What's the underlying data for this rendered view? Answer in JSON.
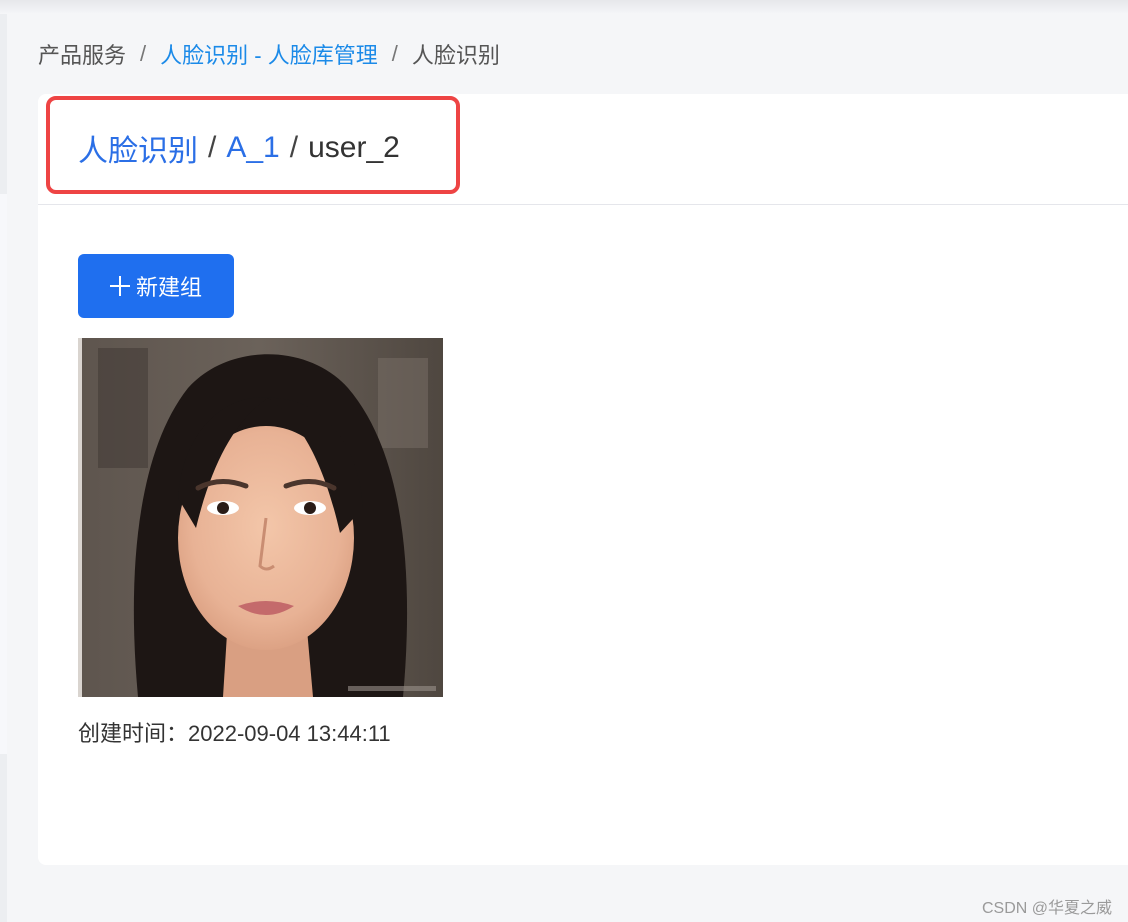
{
  "breadcrumb": {
    "items": [
      "产品服务",
      "人脸识别 - 人脸库管理",
      "人脸识别"
    ],
    "separator": "/"
  },
  "header": {
    "crumbs": [
      "人脸识别",
      "A_1",
      "user_2"
    ],
    "separator": "/"
  },
  "toolbar": {
    "new_group_label": "新建组",
    "new_group_icon": "plus-icon"
  },
  "face": {
    "photo_alt": "face photo",
    "created_label": "创建时间：2022-09-04 13:44:11"
  },
  "colors": {
    "primary": "#1f6fef",
    "link": "#1b8ae8",
    "highlight_border": "#ee4444"
  },
  "watermark": "CSDN @华夏之威"
}
